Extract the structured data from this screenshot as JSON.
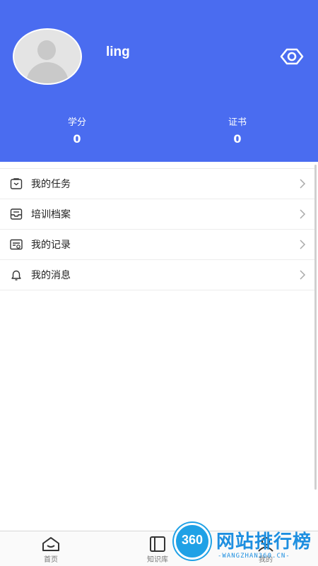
{
  "profile": {
    "username": "ling",
    "stats": [
      {
        "label": "学分",
        "value": "0"
      },
      {
        "label": "证书",
        "value": "0"
      }
    ]
  },
  "menu": {
    "items": [
      {
        "label": "我的任务",
        "icon": "task-bag-icon"
      },
      {
        "label": "培训档案",
        "icon": "archive-tray-icon"
      },
      {
        "label": "我的记录",
        "icon": "record-card-icon"
      },
      {
        "label": "我的消息",
        "icon": "bell-icon"
      }
    ]
  },
  "tabbar": {
    "tabs": [
      {
        "label": "首页",
        "icon": "home-icon"
      },
      {
        "label": "知识库",
        "icon": "book-icon"
      },
      {
        "label": "我的",
        "icon": "user-icon"
      }
    ]
  },
  "watermark": {
    "badge": "360",
    "title": "网站排行榜",
    "subtitle": "-WANGZHAN360.CN-"
  },
  "colors": {
    "header_bg": "#4a6cf0",
    "watermark": "#1e8fe0"
  }
}
